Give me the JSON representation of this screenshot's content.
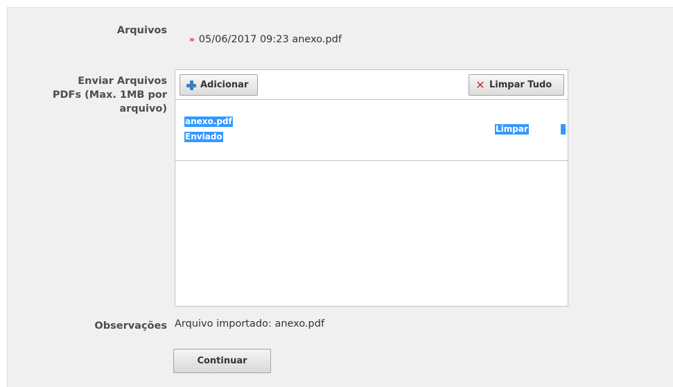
{
  "files": {
    "label": "Arquivos",
    "entry": "05/06/2017 09:23 anexo.pdf",
    "bullet": "»"
  },
  "upload": {
    "label_line1": "Enviar Arquivos",
    "label_line2": "PDFs (Max. 1MB por",
    "label_line3": "arquivo)",
    "add_button": "Adicionar",
    "clear_all_button": "Limpar Tudo",
    "file_name": "anexo.pdf",
    "file_status": "Enviado",
    "clear_link": "Limpar"
  },
  "notes": {
    "label": "Observações",
    "value": "Arquivo importado: anexo.pdf"
  },
  "continue_button": "Continuar",
  "colors": {
    "selection": "#3399ff",
    "bullet": "#d41f1f",
    "background": "#f0f0f0"
  }
}
